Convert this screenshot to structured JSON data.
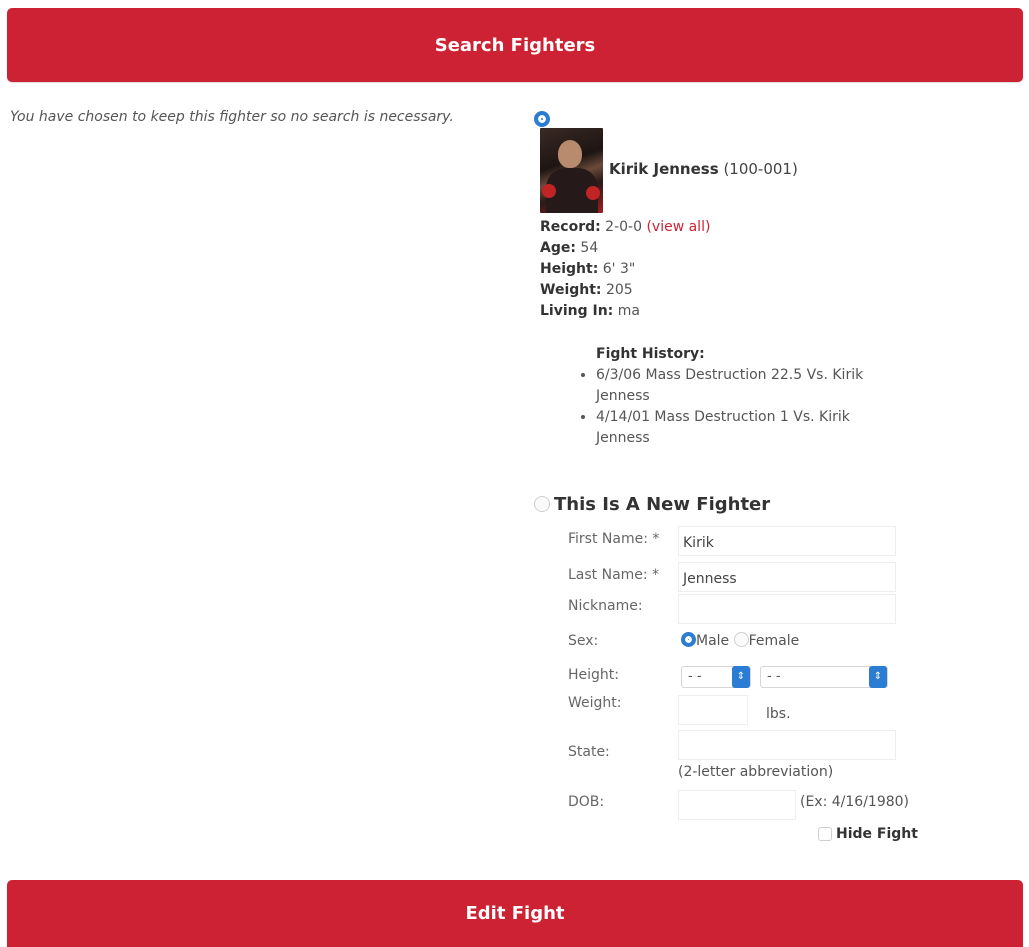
{
  "header": {
    "title": "Search Fighters"
  },
  "note": "You have chosen to keep this fighter so no search is necessary.",
  "fighter": {
    "name": "Kirik Jenness",
    "id": "(100-001)",
    "record_label": "Record:",
    "record": "2-0-0",
    "view_all": "(view all)",
    "age_label": "Age:",
    "age": "54",
    "height_label": "Height:",
    "height": "6' 3\"",
    "weight_label": "Weight:",
    "weight": "205",
    "living_label": "Living In:",
    "living": "ma"
  },
  "history": {
    "title": "Fight History:",
    "items": [
      "6/3/06 Mass Destruction 22.5 Vs. Kirik Jenness",
      "4/14/01 Mass Destruction 1 Vs. Kirik Jenness"
    ]
  },
  "new_fighter": {
    "title": "This Is A New Fighter",
    "first_label": "First Name: *",
    "first_value": "Kirik",
    "last_label": "Last Name: *",
    "last_value": "Jenness",
    "nick_label": "Nickname:",
    "nick_value": "",
    "sex_label": "Sex:",
    "male": "Male",
    "female": "Female",
    "height_label": "Height:",
    "height_ft": "- -",
    "height_in": "- -",
    "weight_label": "Weight:",
    "weight_unit": "lbs.",
    "state_label": "State:",
    "state_hint": "(2-letter abbreviation)",
    "dob_label": "DOB:",
    "dob_hint": "(Ex: 4/16/1980)",
    "hide_fight": "Hide Fight"
  },
  "footer": {
    "title": "Edit Fight"
  },
  "colors": {
    "accent": "#cc2233",
    "radio": "#2b7cd3"
  },
  "icons": {
    "radio_selected": "radio-selected-icon",
    "select_arrow": "chevron-updown-icon"
  }
}
